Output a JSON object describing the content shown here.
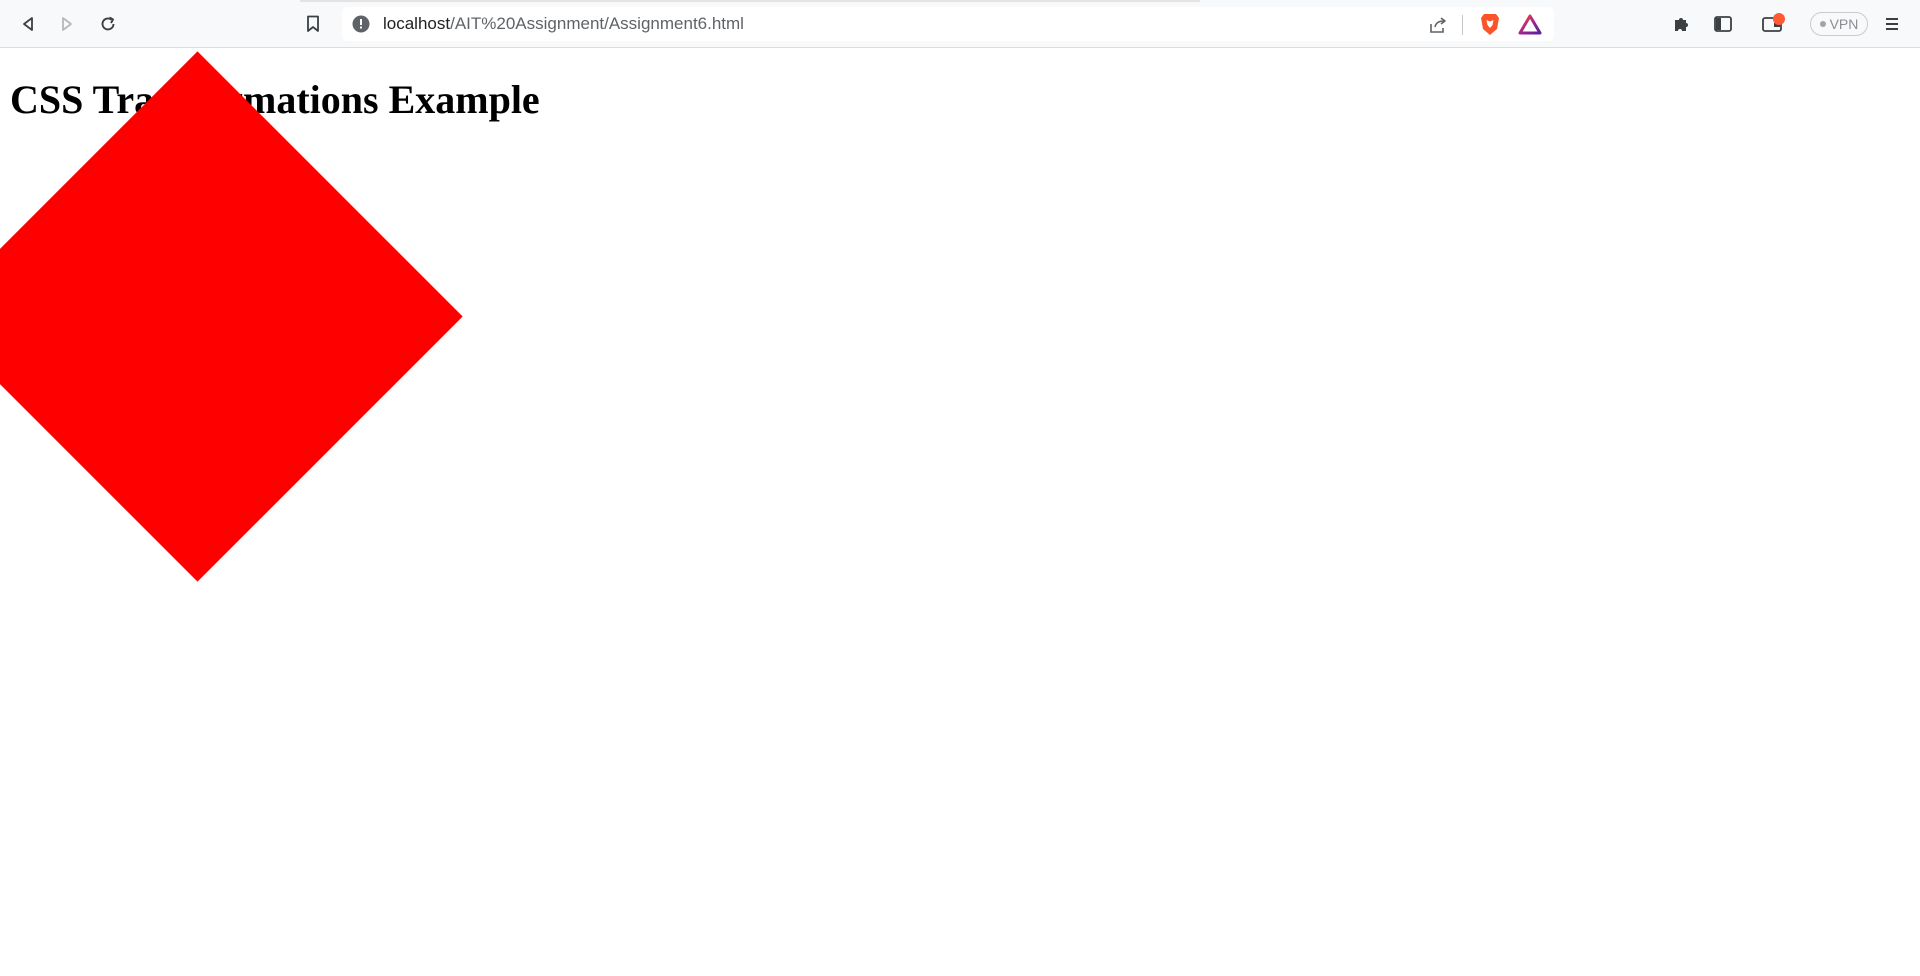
{
  "browser": {
    "address_bar": {
      "url_host": "localhost",
      "url_path": "/AIT%20Assignment/Assignment6.html"
    },
    "vpn_label": "VPN",
    "icons": {
      "back": "back-arrow-icon",
      "forward": "forward-arrow-icon",
      "reload": "reload-icon",
      "bookmark": "bookmark-icon",
      "site_info": "info-icon",
      "share": "share-icon",
      "brave_shields": "brave-lion-icon",
      "brave_rewards": "rewards-triangle-icon",
      "extensions": "puzzle-icon",
      "sidebar": "sidebar-icon",
      "wallet": "wallet-icon",
      "menu": "hamburger-menu-icon"
    }
  },
  "page": {
    "heading": "CSS Transformations Example",
    "box": {
      "color": "#ff0000",
      "rotation_degrees": 45
    }
  },
  "colors": {
    "brave_orange": "#fb542b",
    "wallet_badge": "#ff5a36",
    "toolbar_bg": "#f8f9fa"
  }
}
